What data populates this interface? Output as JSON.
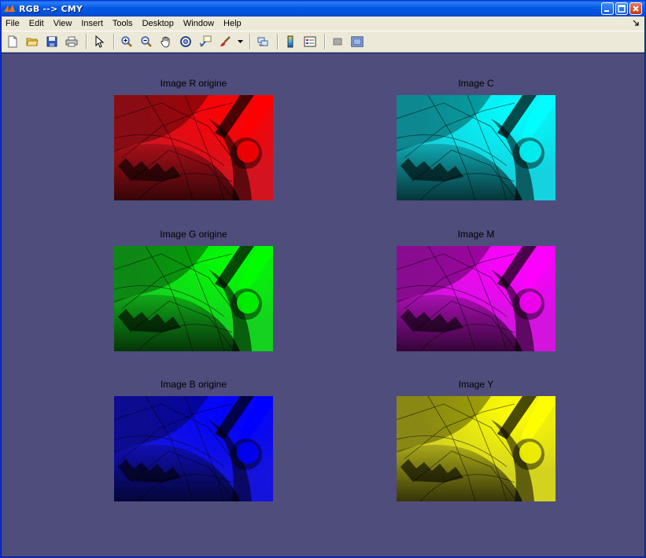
{
  "window": {
    "title": "RGB --> CMY"
  },
  "menu": {
    "items": [
      "File",
      "Edit",
      "View",
      "Insert",
      "Tools",
      "Desktop",
      "Window",
      "Help"
    ]
  },
  "toolbar": {
    "icons": [
      "new-figure-icon",
      "open-file-icon",
      "save-icon",
      "print-icon",
      "pointer-icon",
      "zoom-in-icon",
      "zoom-out-icon",
      "pan-icon",
      "rotate-3d-icon",
      "data-cursor-icon",
      "brush-icon",
      "link-plot-icon",
      "colorbar-icon",
      "legend-icon",
      "hide-plot-tools-icon",
      "show-plot-tools-icon"
    ]
  },
  "panels": {
    "r": {
      "title": "Image R origine",
      "color": "#ff0000"
    },
    "g": {
      "title": "Image G origine",
      "color": "#00ff00"
    },
    "b": {
      "title": "Image B origine",
      "color": "#0000ff"
    },
    "c": {
      "title": "Image C",
      "color": "#00ffff"
    },
    "m": {
      "title": "Image M",
      "color": "#ff00ff"
    },
    "y": {
      "title": "Image Y",
      "color": "#ffff00"
    }
  },
  "colors": {
    "figure_background": "#4f4d7c",
    "titlebar": "#0054e3"
  }
}
